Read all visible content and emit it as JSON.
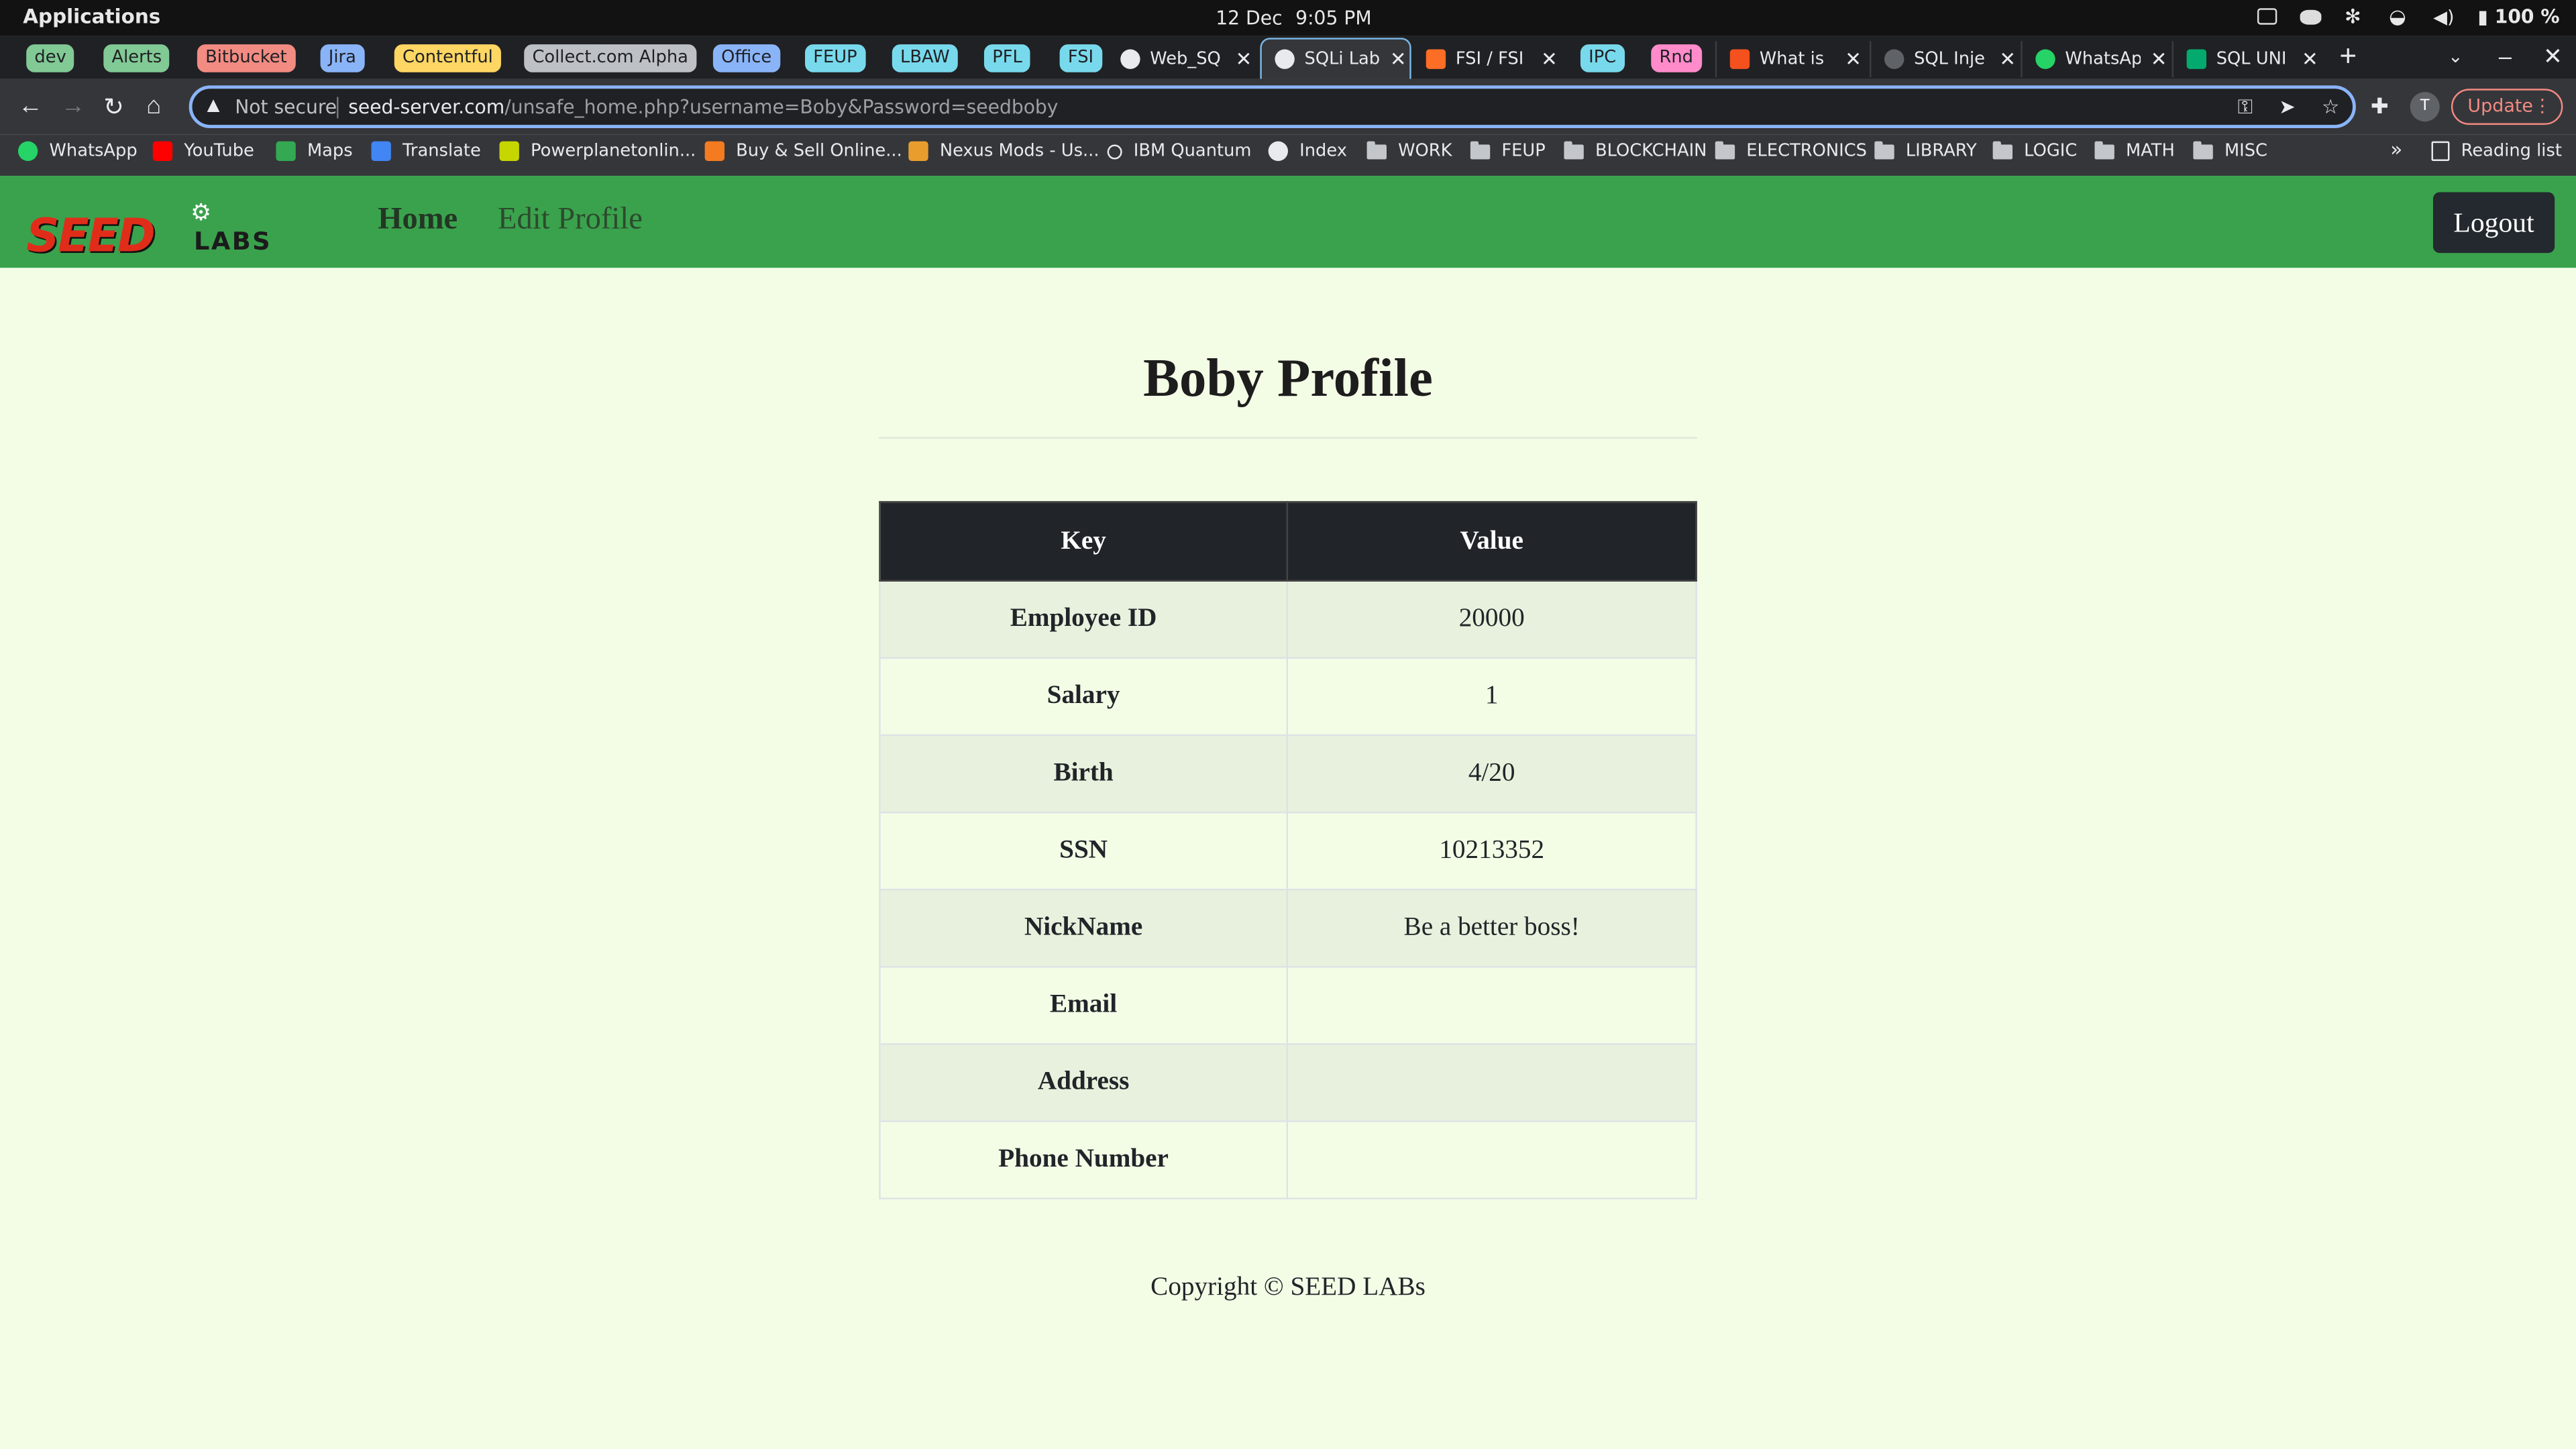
{
  "os_bar": {
    "applications": "Applications",
    "date": "12 Dec",
    "time": "9:05 PM",
    "battery": "100 %"
  },
  "tab_groups": [
    {
      "label": "dev",
      "color": "#81c995"
    },
    {
      "label": "Alerts",
      "color": "#81c995"
    },
    {
      "label": "Bitbucket",
      "color": "#f28b82"
    },
    {
      "label": "Jira",
      "color": "#8ab4f8"
    },
    {
      "label": "Contentful",
      "color": "#fdd663"
    },
    {
      "label": "Collect.com Alpha",
      "color": "#bdc1c6"
    },
    {
      "label": "Office",
      "color": "#8ab4f8"
    },
    {
      "label": "FEUP",
      "color": "#78d9ec"
    },
    {
      "label": "LBAW",
      "color": "#78d9ec"
    },
    {
      "label": "PFL",
      "color": "#78d9ec"
    },
    {
      "label": "FSI",
      "color": "#78d9ec"
    },
    {
      "label": "IPC",
      "color": "#78d9ec"
    },
    {
      "label": "Rnd",
      "color": "#ff8bcb"
    }
  ],
  "tabs": [
    {
      "title": "Web_SQ",
      "icon": "globe-icon"
    },
    {
      "title": "SQLi Lab",
      "icon": "globe-icon",
      "active": true
    },
    {
      "title": "FSI / FSI",
      "icon": "gitlab-icon"
    },
    {
      "title": "What is",
      "icon": "bolt-icon"
    },
    {
      "title": "SQL Inje",
      "icon": "site-icon"
    },
    {
      "title": "WhatsAp",
      "icon": "whatsapp-icon"
    },
    {
      "title": "SQL UNI",
      "icon": "w3-icon"
    }
  ],
  "omnibox": {
    "security": "Not secure",
    "host": "seed-server.com",
    "path": "/unsafe_home.php?username=Boby&Password=seedboby"
  },
  "update_label": "Update",
  "avatar_letter": "T",
  "bookmarks": [
    {
      "label": "WhatsApp",
      "type": "site"
    },
    {
      "label": "YouTube",
      "type": "site"
    },
    {
      "label": "Maps",
      "type": "site"
    },
    {
      "label": "Translate",
      "type": "site"
    },
    {
      "label": "Powerplanetonlin...",
      "type": "site"
    },
    {
      "label": "Buy & Sell Online...",
      "type": "site"
    },
    {
      "label": "Nexus Mods - Us...",
      "type": "site"
    },
    {
      "label": "IBM Quantum",
      "type": "site"
    },
    {
      "label": "Index",
      "type": "site"
    },
    {
      "label": "WORK",
      "type": "folder"
    },
    {
      "label": "FEUP",
      "type": "folder"
    },
    {
      "label": "BLOCKCHAIN",
      "type": "folder"
    },
    {
      "label": "ELECTRONICS",
      "type": "folder"
    },
    {
      "label": "LIBRARY",
      "type": "folder"
    },
    {
      "label": "LOGIC",
      "type": "folder"
    },
    {
      "label": "MATH",
      "type": "folder"
    },
    {
      "label": "MISC",
      "type": "folder"
    }
  ],
  "overflow_chevron": "»",
  "reading_list": "Reading list",
  "site": {
    "logo_main": "SEED",
    "logo_sub": "LABS",
    "nav_home": "Home",
    "nav_edit": "Edit Profile",
    "logout": "Logout",
    "title": "Boby Profile",
    "table_headers": [
      "Key",
      "Value"
    ],
    "rows": [
      {
        "key": "Employee ID",
        "value": "20000"
      },
      {
        "key": "Salary",
        "value": "1"
      },
      {
        "key": "Birth",
        "value": "4/20"
      },
      {
        "key": "SSN",
        "value": "10213352"
      },
      {
        "key": "NickName",
        "value": "Be a better boss!"
      },
      {
        "key": "Email",
        "value": ""
      },
      {
        "key": "Address",
        "value": ""
      },
      {
        "key": "Phone Number",
        "value": ""
      }
    ],
    "footer": "Copyright © SEED LABs"
  }
}
